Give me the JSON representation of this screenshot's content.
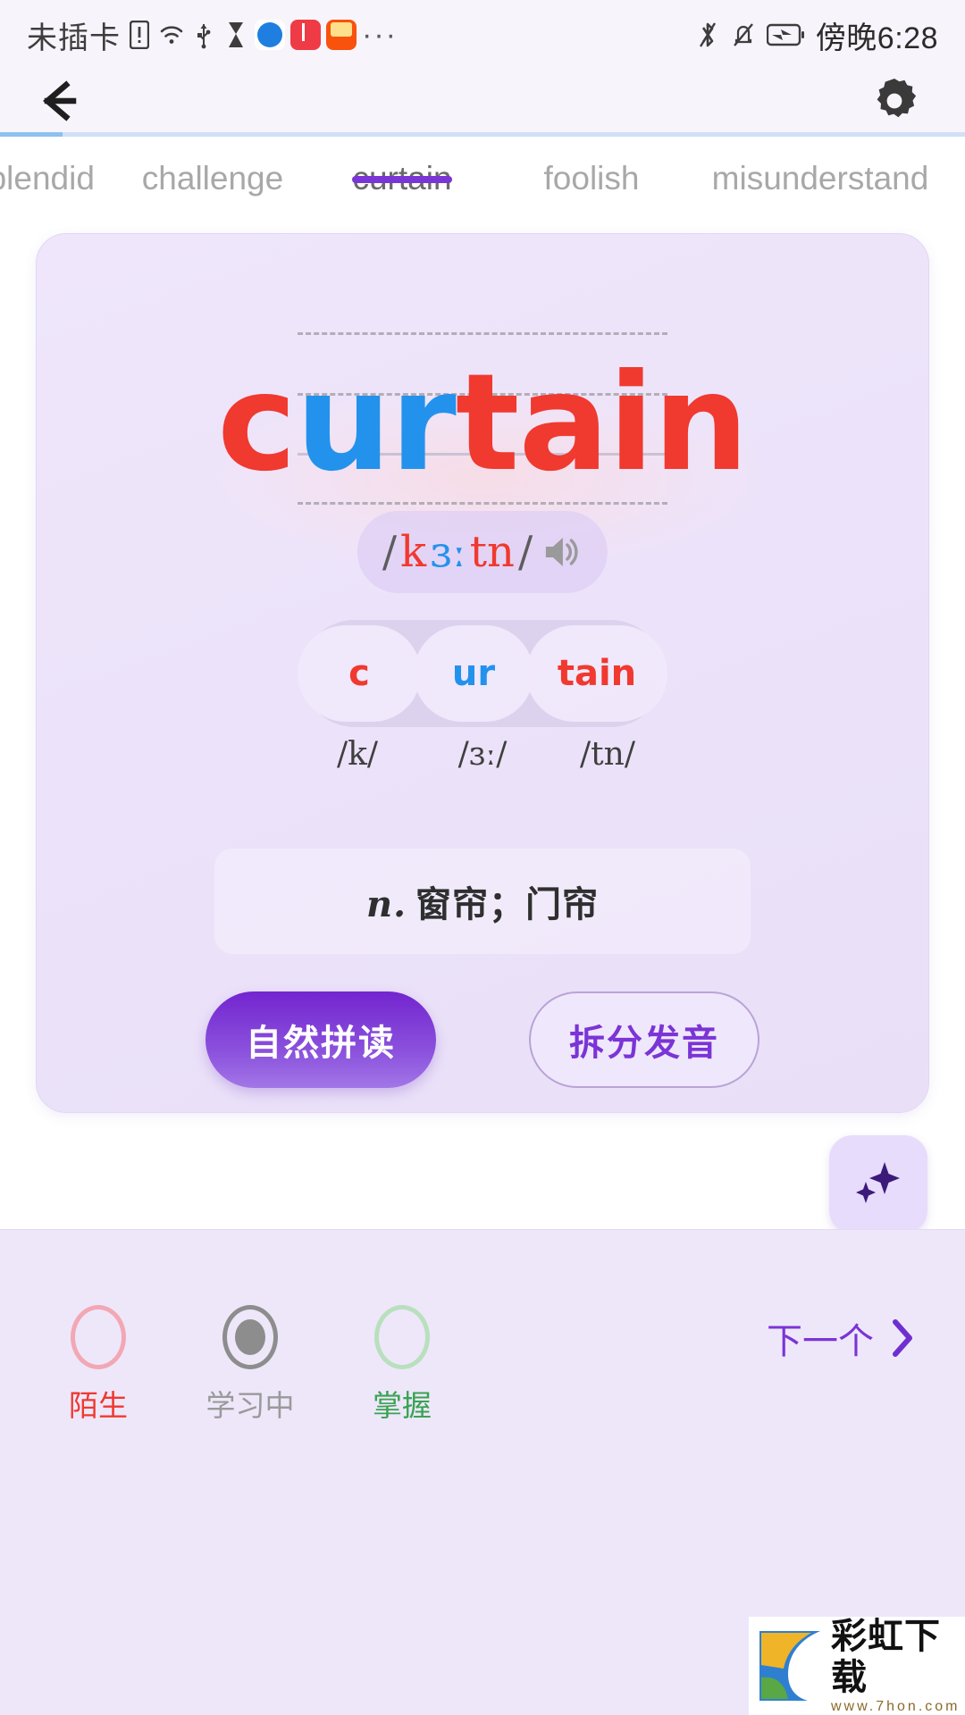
{
  "status_bar": {
    "carrier": "未插卡",
    "icons": [
      "sim-alert-icon",
      "wifi-icon",
      "usb-icon",
      "hourglass-icon",
      "browser-app-icon",
      "book-app-icon",
      "video-app-icon",
      "more-dots-icon"
    ],
    "more": "···",
    "right_icons": [
      "bluetooth-icon",
      "notification-muted-icon",
      "battery-charging-icon"
    ],
    "time": "傍晚6:28"
  },
  "header": {
    "back_label": "←",
    "settings_label": "⚙",
    "progress_percent": 6.5
  },
  "tabs": {
    "items": [
      {
        "label": "splendid",
        "active": false
      },
      {
        "label": "challenge",
        "active": false
      },
      {
        "label": "curtain",
        "active": true
      },
      {
        "label": "foolish",
        "active": false
      },
      {
        "label": "misunderstand",
        "active": false
      }
    ]
  },
  "card": {
    "word": "curtain",
    "word_parts": [
      {
        "text": "c",
        "color": "#f0392f"
      },
      {
        "text": "ur",
        "color": "#2392ec"
      },
      {
        "text": "tain",
        "color": "#f0392f"
      }
    ],
    "phonetic": {
      "open_slash": "/",
      "close_slash": "/",
      "parts": [
        {
          "text": "k",
          "color": "#f0392f"
        },
        {
          "text": "ɜː",
          "color": "#2392ec"
        },
        {
          "text": "tn",
          "color": "#f0392f"
        }
      ],
      "speaker_icon": "speaker-icon"
    },
    "syllables": [
      {
        "text": "c",
        "ipa": "/k/",
        "color": "#f0392f"
      },
      {
        "text": "ur",
        "ipa": "/ɜː/",
        "color": "#2392ec"
      },
      {
        "text": "tain",
        "ipa": "/tn/",
        "color": "#f0392f"
      }
    ],
    "definition_pos": "n.",
    "definition_text": "窗帘；门帘",
    "buttons": {
      "primary": "自然拼读",
      "secondary": "拆分发音"
    },
    "fab_icon": "sparkles-icon"
  },
  "bottom": {
    "statuses": [
      {
        "label": "陌生",
        "state": "unselected",
        "color": "#f0392f"
      },
      {
        "label": "学习中",
        "state": "selected",
        "color": "#9a9a9a"
      },
      {
        "label": "掌握",
        "state": "unselected",
        "color": "#39a353"
      }
    ],
    "next_label": "下一个",
    "next_icon": "chevron-right-icon"
  },
  "watermark": {
    "title": "彩虹下载",
    "url": "www.7hon.com"
  },
  "colors": {
    "accent_purple": "#7b34d6",
    "word_red": "#f0392f",
    "word_blue": "#2392ec",
    "card_bg": "#ece3fa",
    "page_bg": "#f5f1fb"
  }
}
